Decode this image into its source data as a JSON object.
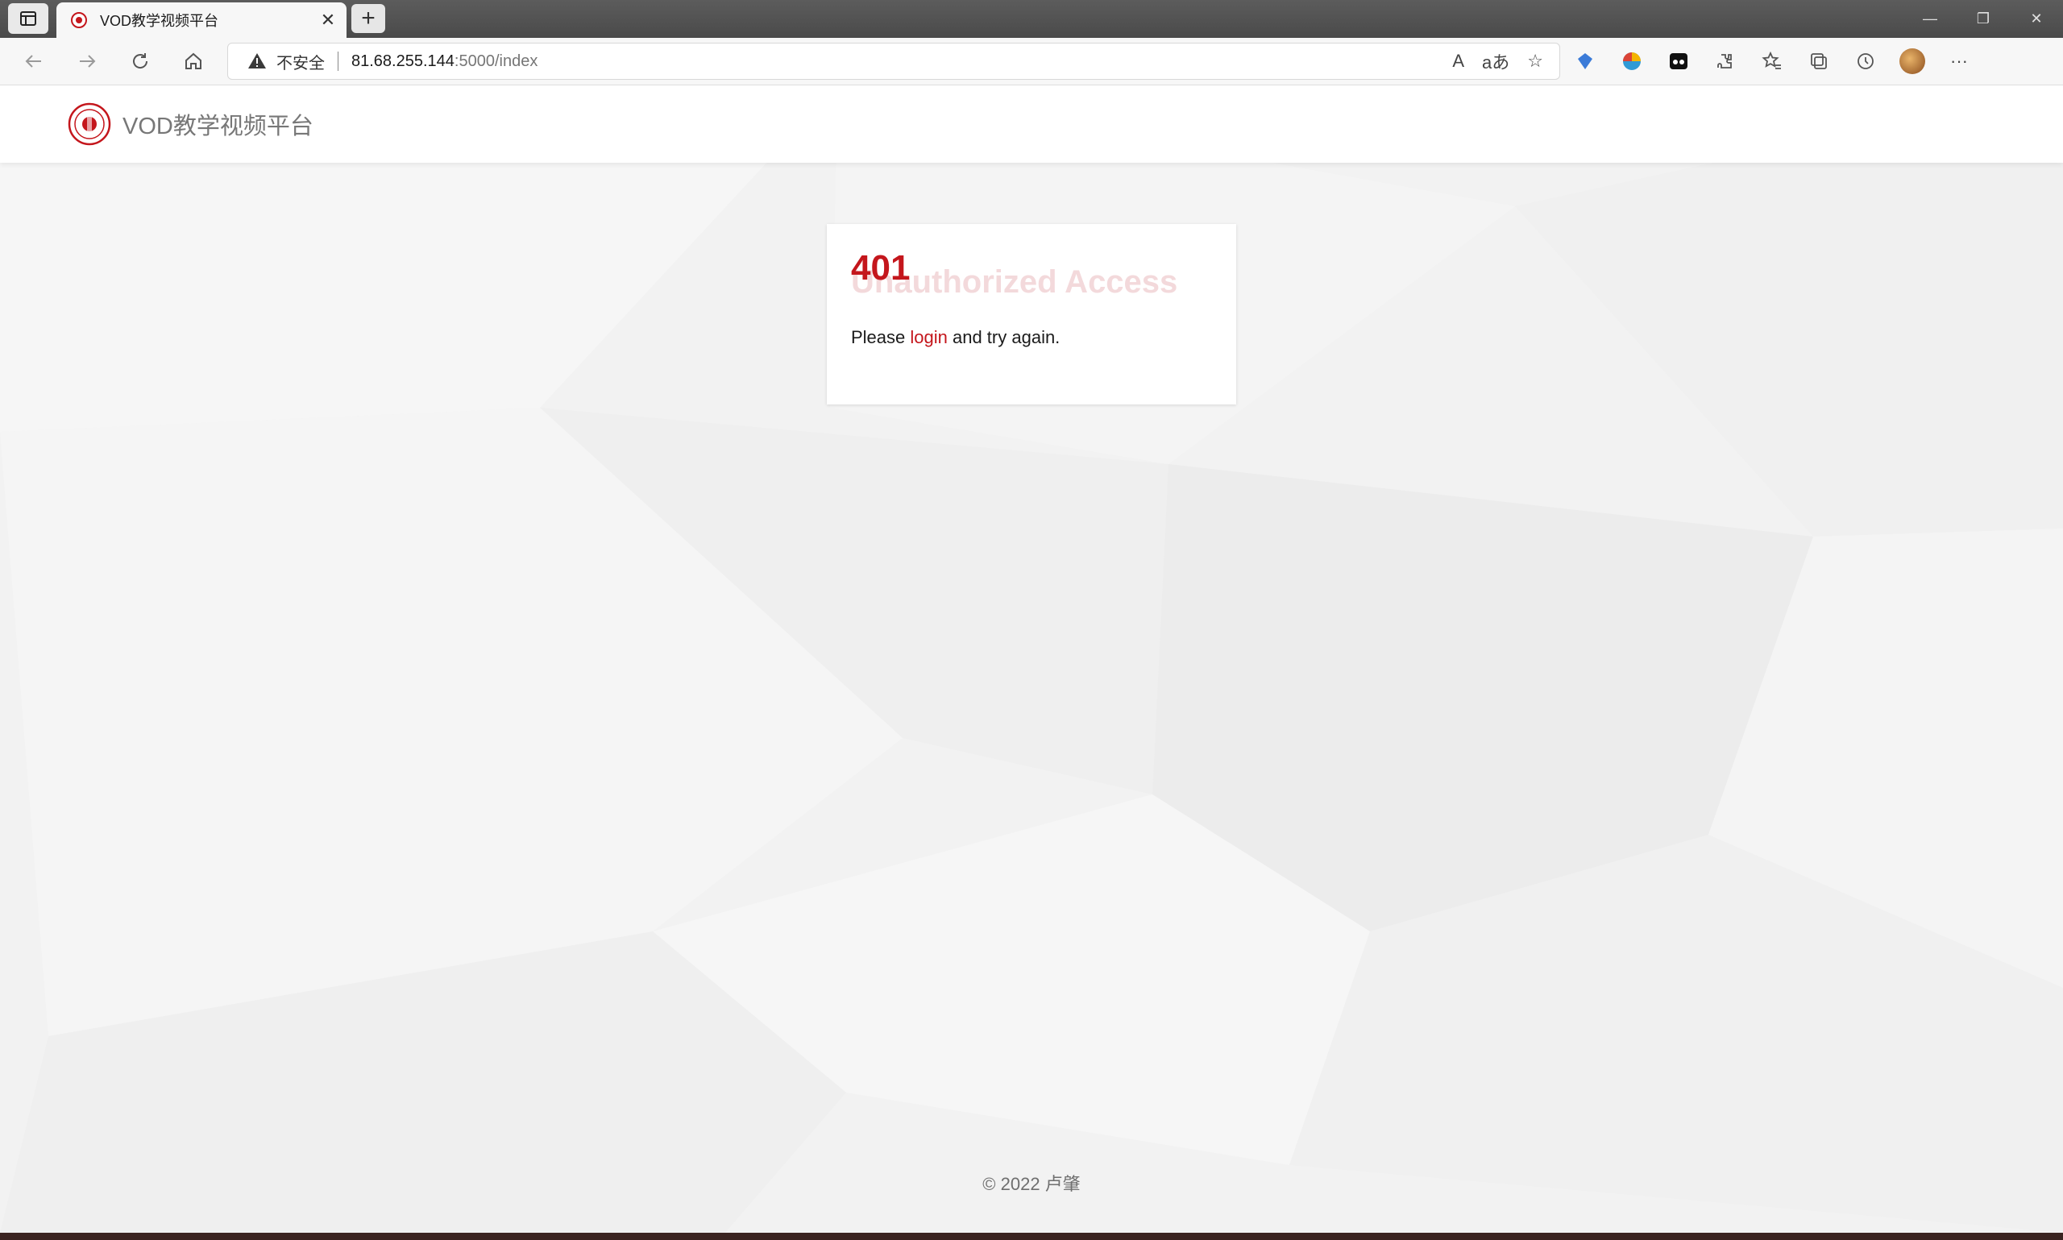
{
  "browser": {
    "tab": {
      "title": "VOD教学视频平台",
      "close_glyph": "✕"
    },
    "new_tab_glyph": "+",
    "address": {
      "security_label": "不安全",
      "host": "81.68.255.144",
      "path": ":5000/index"
    },
    "window_controls": {
      "minimize": "—",
      "maximize": "❐",
      "close": "✕"
    },
    "address_icons": [
      "read-aloud-icon",
      "translate-icon",
      "add-favorite-icon"
    ],
    "extension_icons": [
      "extension-blue-icon",
      "extension-color-icon",
      "extension-mask-icon",
      "extensions-icon",
      "favorites-icon",
      "collections-icon",
      "history-icon",
      "profile-avatar",
      "more-icon"
    ],
    "address_icon_glyphs": {
      "read_aloud": "A",
      "translate": "aあ",
      "favorite": "☆"
    },
    "more_glyph": "···"
  },
  "site": {
    "brand": "VOD教学视频平台",
    "brand_color": "#c4161c"
  },
  "error": {
    "code": "401",
    "title": "Unauthorized Access",
    "message_before": "Please ",
    "link_text": "login",
    "message_after": " and try again."
  },
  "footer": {
    "text": "© 2022 卢肇"
  }
}
